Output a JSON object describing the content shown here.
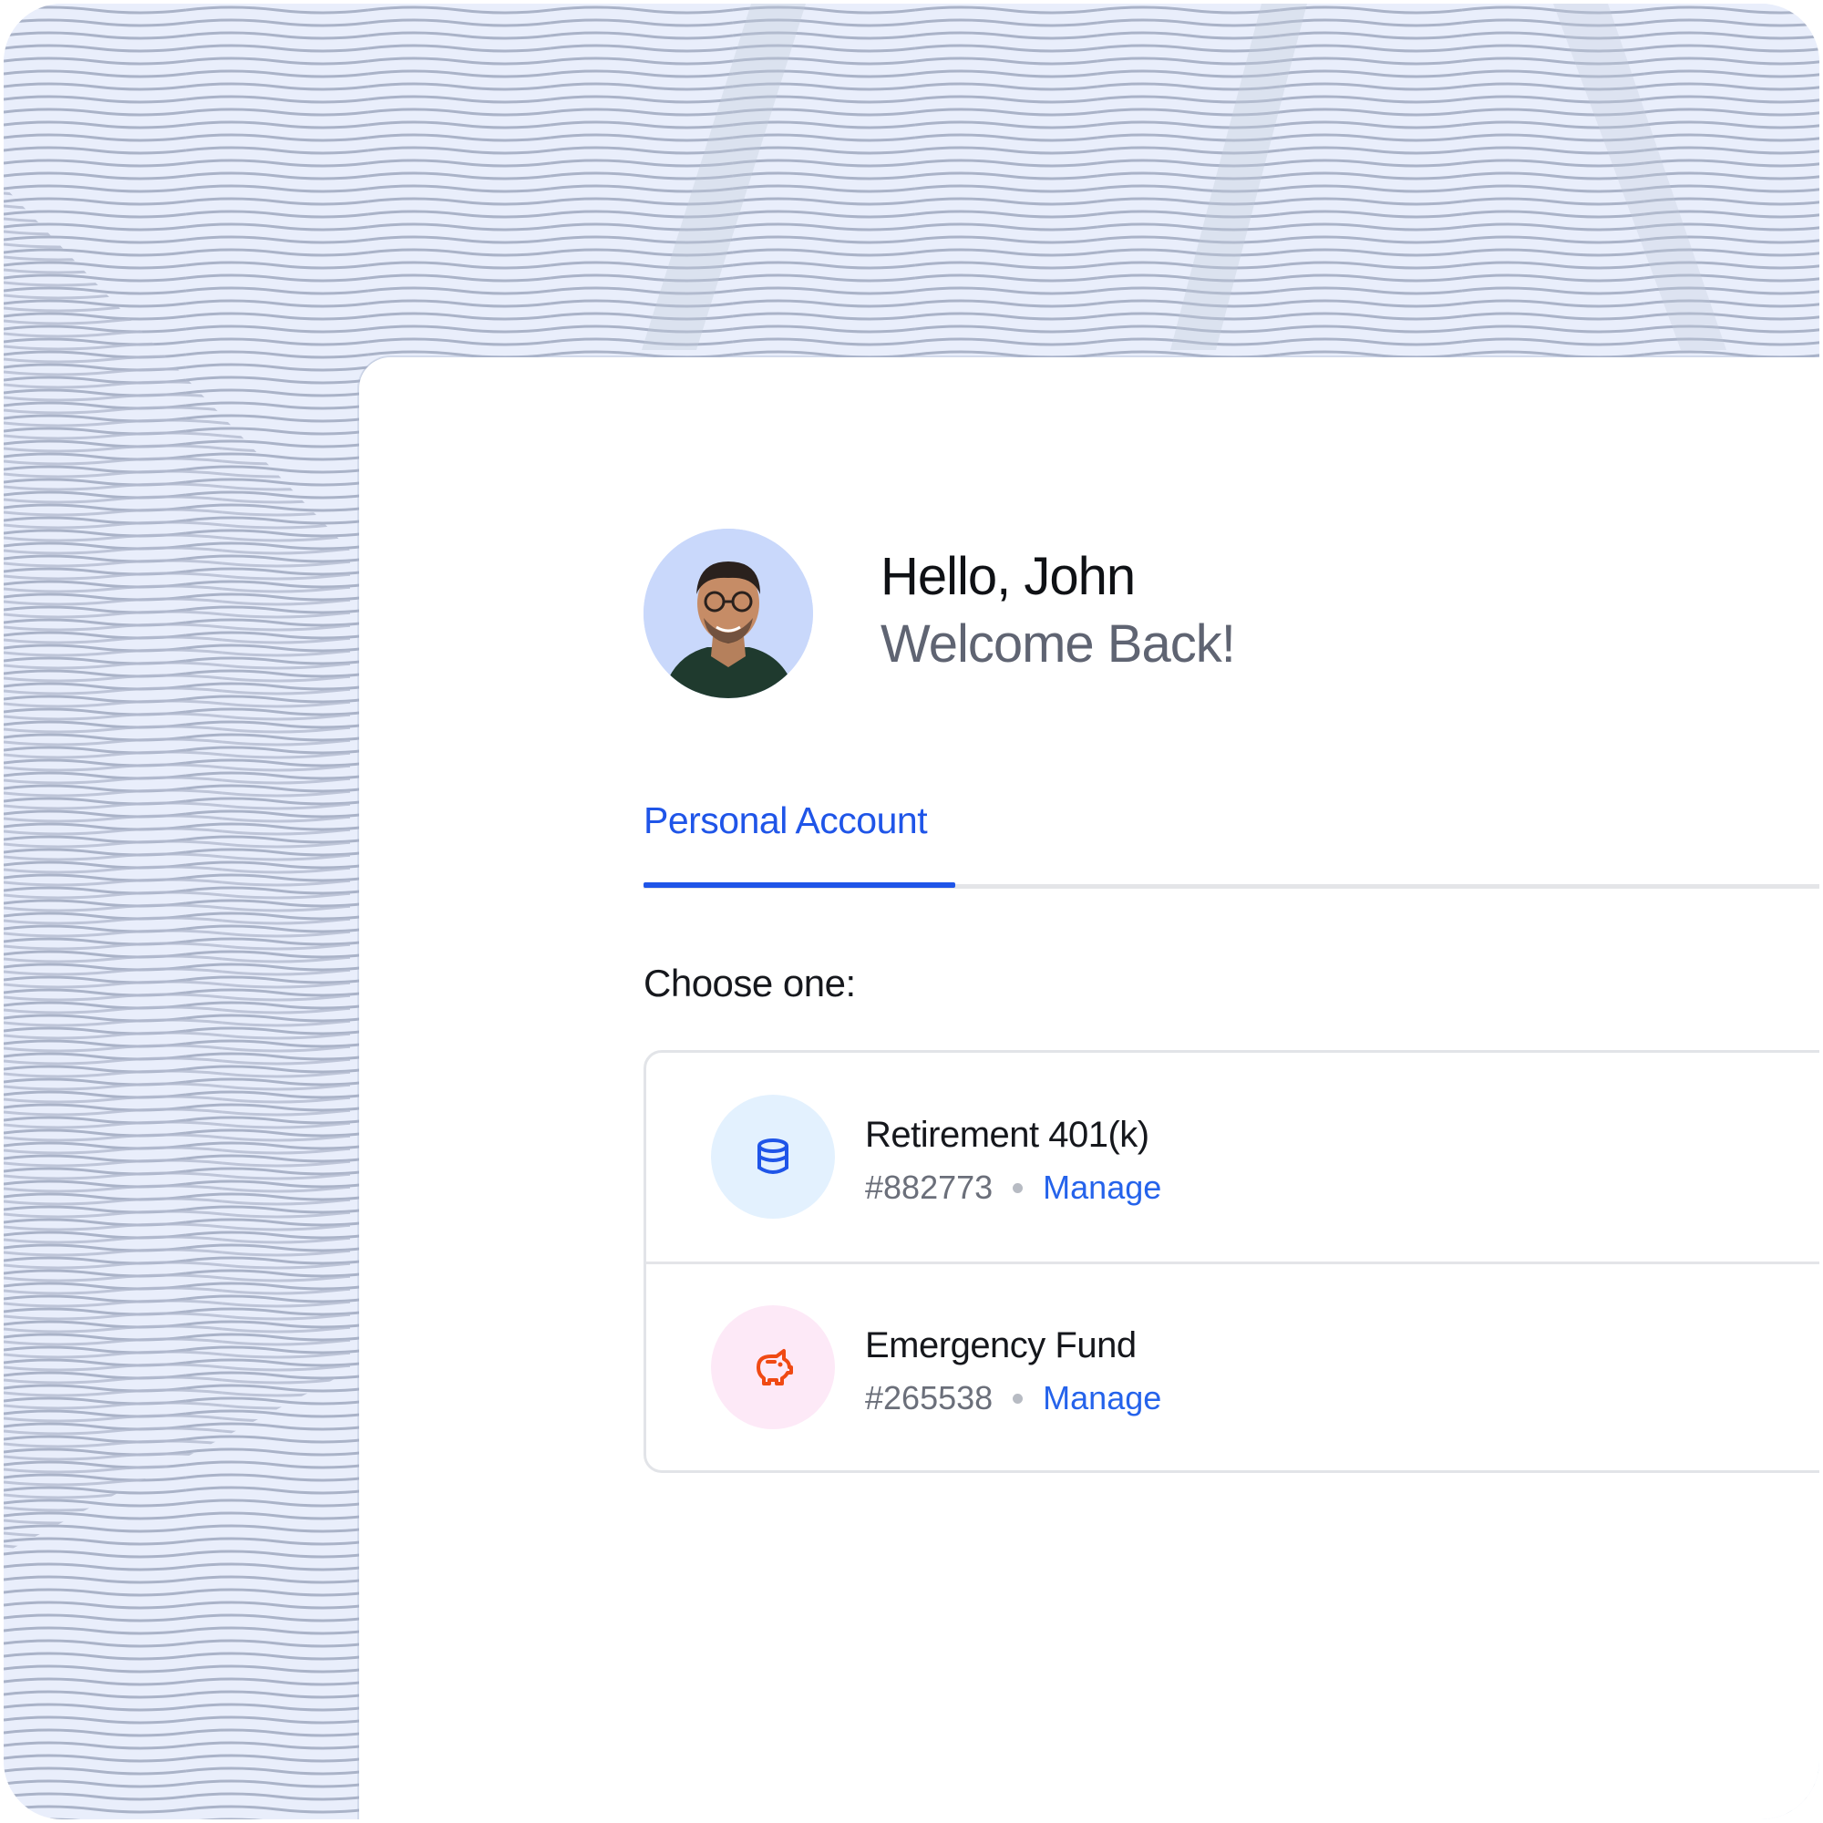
{
  "header": {
    "greeting": "Hello, John",
    "subtitle": "Welcome Back!"
  },
  "tabs": [
    {
      "label": "Personal Account",
      "active": true
    }
  ],
  "prompt": "Choose one:",
  "accounts": [
    {
      "name": "Retirement 401(k)",
      "number": "#882773",
      "action": "Manage",
      "icon": "database-stack-icon",
      "icon_color": "#1f55e8",
      "icon_bg": "#e3f1fe"
    },
    {
      "name": "Emergency Fund",
      "number": "#265538",
      "action": "Manage",
      "icon": "piggy-bank-icon",
      "icon_color": "#f04a14",
      "icon_bg": "#fde9f7"
    }
  ],
  "colors": {
    "accent": "#1f55e8",
    "link": "#2563eb",
    "background_pattern": "#e8edfb"
  }
}
